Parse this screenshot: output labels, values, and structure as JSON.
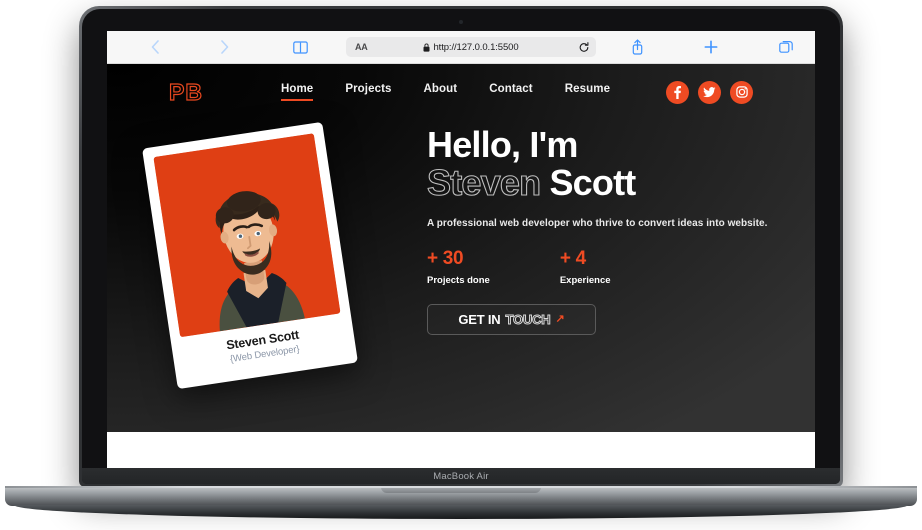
{
  "device": {
    "model_label": "MacBook Air"
  },
  "browser": {
    "back_icon": "chevron-left-icon",
    "forward_icon": "chevron-right-icon",
    "sidebar_icon": "book-icon",
    "reader_label": "AA",
    "lock_icon": "lock-icon",
    "url": "http://127.0.0.1:5500",
    "reload_icon": "reload-icon",
    "share_icon": "share-icon",
    "new_tab_icon": "plus-icon",
    "tabs_icon": "tabs-icon"
  },
  "site": {
    "logo": "PB",
    "nav": [
      {
        "label": "Home",
        "active": true
      },
      {
        "label": "Projects",
        "active": false
      },
      {
        "label": "About",
        "active": false
      },
      {
        "label": "Contact",
        "active": false
      },
      {
        "label": "Resume",
        "active": false
      }
    ],
    "social": [
      {
        "name": "facebook-icon"
      },
      {
        "name": "twitter-icon"
      },
      {
        "name": "instagram-icon"
      }
    ],
    "card": {
      "name": "Steven Scott",
      "role": "{Web Developer}",
      "photo_alt": "portrait-photo"
    },
    "hero": {
      "greeting": "Hello, I'm",
      "name_outline": "Steven",
      "name_solid": "Scott",
      "subtitle": "A professional web developer who thrive to convert ideas into website.",
      "stats": [
        {
          "value": "+ 30",
          "label": "Projects done"
        },
        {
          "value": "+ 4",
          "label": "Experience"
        }
      ],
      "cta": {
        "solid": "GET IN",
        "outline": "TOUCH",
        "arrow": "↗"
      }
    }
  },
  "colors": {
    "accent": "#ef4b23",
    "photo_bg": "#df3f14",
    "hero_bg_dark": "#000000",
    "hero_bg_light": "#323232",
    "toolbar_blue": "#3f93ff"
  }
}
